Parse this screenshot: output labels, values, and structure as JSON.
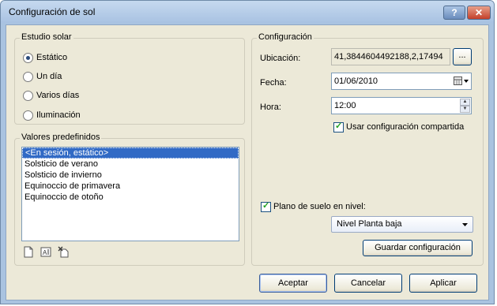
{
  "window": {
    "title": "Configuración de sol",
    "help_label": "?",
    "close_label": "✕"
  },
  "solar_study": {
    "title": "Estudio solar",
    "options": [
      {
        "label": "Estático",
        "selected": true
      },
      {
        "label": "Un día",
        "selected": false
      },
      {
        "label": "Varios días",
        "selected": false
      },
      {
        "label": "Iluminación",
        "selected": false
      }
    ]
  },
  "presets": {
    "title": "Valores predefinidos",
    "items": [
      "<En sesión, estático>",
      "Solsticio de verano",
      "Solsticio de invierno",
      "Equinoccio de primavera",
      "Equinoccio de otoño"
    ],
    "selected_index": 0,
    "icons": [
      "new-preset-icon",
      "rename-preset-icon",
      "delete-preset-icon"
    ]
  },
  "configuration": {
    "title": "Configuración",
    "location_label": "Ubicación:",
    "location_value": "41,3844604492188,2,17494",
    "location_browse_label": "...",
    "date_label": "Fecha:",
    "date_value": "01/06/2010",
    "time_label": "Hora:",
    "time_value": "12:00",
    "shared_label": "Usar configuración compartida",
    "shared_checked": true,
    "ground_label": "Plano de suelo en nivel:",
    "ground_checked": true,
    "level_value": "Nivel Planta baja",
    "save_label": "Guardar configuración"
  },
  "buttons": {
    "ok": "Aceptar",
    "cancel": "Cancelar",
    "apply": "Aplicar"
  }
}
